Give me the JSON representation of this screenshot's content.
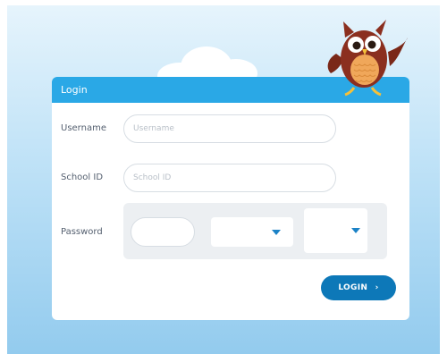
{
  "card": {
    "title": "Login"
  },
  "form": {
    "username": {
      "label": "Username",
      "placeholder": "Username"
    },
    "school_id": {
      "label": "School ID",
      "placeholder": "School ID"
    },
    "password": {
      "label": "Password"
    }
  },
  "login_button": {
    "label": "LOGIN",
    "icon": "arrow-right-icon"
  },
  "colors": {
    "header": "#2aa8e6",
    "button": "#0d78b8",
    "accent": "#1b82c6",
    "owl_body": "#8b2f1f"
  }
}
